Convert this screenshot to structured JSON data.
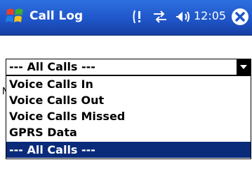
{
  "titlebar": {
    "title": "Call Log",
    "clock": "12:05",
    "colors": {
      "gradient_top": "#2e6fe0",
      "gradient_bottom": "#173fa3"
    }
  },
  "status_icons": [
    "notification-icon",
    "connectivity-icon",
    "volume-icon"
  ],
  "filter": {
    "selected": "--- All Calls ---",
    "options": [
      "Voice Calls In",
      "Voice Calls Out",
      "Voice Calls Missed",
      "GPRS Data",
      "--- All Calls ---"
    ],
    "selected_index": 4,
    "highlight_color": "#0a2a7a"
  },
  "background_peek": "N"
}
